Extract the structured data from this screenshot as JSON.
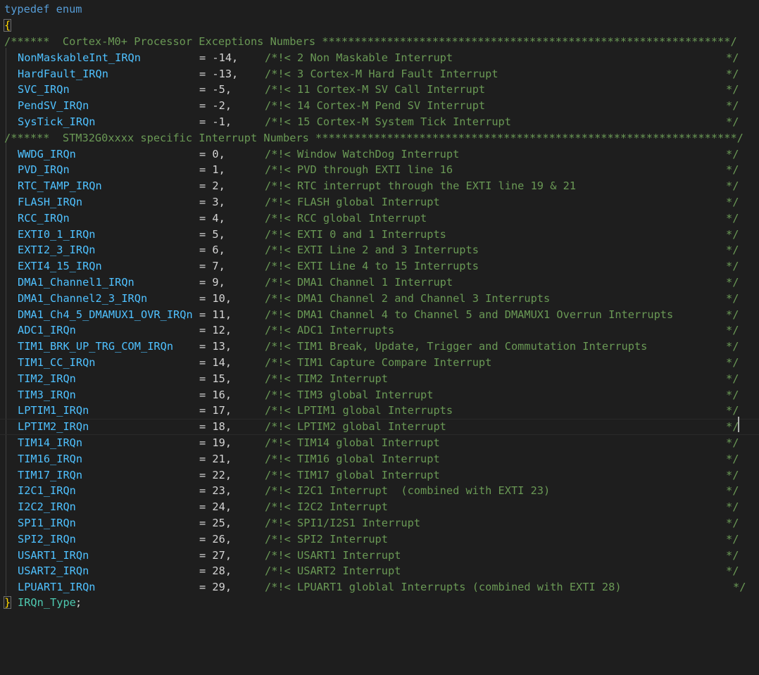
{
  "header": {
    "keyword": "typedef enum",
    "open_brace": "{"
  },
  "sections": [
    {
      "text": "/******  Cortex-M0+ Processor Exceptions Numbers ***************************************************************/"
    },
    {
      "text": "/******  STM32G0xxxx specific Interrupt Numbers *****************************************************************/"
    }
  ],
  "enumerators": [
    {
      "name": "NonMaskableInt_IRQn",
      "value": "= -14,",
      "comment": "/*!< 2 Non Maskable Interrupt",
      "end": "*/"
    },
    {
      "name": "HardFault_IRQn",
      "value": "= -13,",
      "comment": "/*!< 3 Cortex-M Hard Fault Interrupt",
      "end": "*/"
    },
    {
      "name": "SVC_IRQn",
      "value": "= -5,",
      "comment": "/*!< 11 Cortex-M SV Call Interrupt",
      "end": "*/"
    },
    {
      "name": "PendSV_IRQn",
      "value": "= -2,",
      "comment": "/*!< 14 Cortex-M Pend SV Interrupt",
      "end": "*/"
    },
    {
      "name": "SysTick_IRQn",
      "value": "= -1,",
      "comment": "/*!< 15 Cortex-M System Tick Interrupt",
      "end": "*/"
    },
    {
      "name": "WWDG_IRQn",
      "value": "= 0,",
      "comment": "/*!< Window WatchDog Interrupt",
      "end": "*/"
    },
    {
      "name": "PVD_IRQn",
      "value": "= 1,",
      "comment": "/*!< PVD through EXTI line 16",
      "end": "*/"
    },
    {
      "name": "RTC_TAMP_IRQn",
      "value": "= 2,",
      "comment": "/*!< RTC interrupt through the EXTI line 19 & 21",
      "end": "*/"
    },
    {
      "name": "FLASH_IRQn",
      "value": "= 3,",
      "comment": "/*!< FLASH global Interrupt",
      "end": "*/"
    },
    {
      "name": "RCC_IRQn",
      "value": "= 4,",
      "comment": "/*!< RCC global Interrupt",
      "end": "*/"
    },
    {
      "name": "EXTI0_1_IRQn",
      "value": "= 5,",
      "comment": "/*!< EXTI 0 and 1 Interrupts",
      "end": "*/"
    },
    {
      "name": "EXTI2_3_IRQn",
      "value": "= 6,",
      "comment": "/*!< EXTI Line 2 and 3 Interrupts",
      "end": "*/"
    },
    {
      "name": "EXTI4_15_IRQn",
      "value": "= 7,",
      "comment": "/*!< EXTI Line 4 to 15 Interrupts",
      "end": "*/"
    },
    {
      "name": "DMA1_Channel1_IRQn",
      "value": "= 9,",
      "comment": "/*!< DMA1 Channel 1 Interrupt",
      "end": "*/"
    },
    {
      "name": "DMA1_Channel2_3_IRQn",
      "value": "= 10,",
      "comment": "/*!< DMA1 Channel 2 and Channel 3 Interrupts",
      "end": "*/"
    },
    {
      "name": "DMA1_Ch4_5_DMAMUX1_OVR_IRQn",
      "value": "= 11,",
      "comment": "/*!< DMA1 Channel 4 to Channel 5 and DMAMUX1 Overrun Interrupts",
      "end": "*/"
    },
    {
      "name": "ADC1_IRQn",
      "value": "= 12,",
      "comment": "/*!< ADC1 Interrupts",
      "end": "*/"
    },
    {
      "name": "TIM1_BRK_UP_TRG_COM_IRQn",
      "value": "= 13,",
      "comment": "/*!< TIM1 Break, Update, Trigger and Commutation Interrupts",
      "end": "*/"
    },
    {
      "name": "TIM1_CC_IRQn",
      "value": "= 14,",
      "comment": "/*!< TIM1 Capture Compare Interrupt",
      "end": "*/"
    },
    {
      "name": "TIM2_IRQn",
      "value": "= 15,",
      "comment": "/*!< TIM2 Interrupt",
      "end": "*/"
    },
    {
      "name": "TIM3_IRQn",
      "value": "= 16,",
      "comment": "/*!< TIM3 global Interrupt",
      "end": "*/"
    },
    {
      "name": "LPTIM1_IRQn",
      "value": "= 17,",
      "comment": "/*!< LPTIM1 global Interrupts",
      "end": "*/"
    },
    {
      "name": "LPTIM2_IRQn",
      "value": "= 18,",
      "comment": "/*!< LPTIM2 global Interrupt",
      "end": "*/"
    },
    {
      "name": "TIM14_IRQn",
      "value": "= 19,",
      "comment": "/*!< TIM14 global Interrupt",
      "end": "*/"
    },
    {
      "name": "TIM16_IRQn",
      "value": "= 21,",
      "comment": "/*!< TIM16 global Interrupt",
      "end": "*/"
    },
    {
      "name": "TIM17_IRQn",
      "value": "= 22,",
      "comment": "/*!< TIM17 global Interrupt",
      "end": "*/"
    },
    {
      "name": "I2C1_IRQn",
      "value": "= 23,",
      "comment": "/*!< I2C1 Interrupt  (combined with EXTI 23)",
      "end": "*/"
    },
    {
      "name": "I2C2_IRQn",
      "value": "= 24,",
      "comment": "/*!< I2C2 Interrupt",
      "end": "*/"
    },
    {
      "name": "SPI1_IRQn",
      "value": "= 25,",
      "comment": "/*!< SPI1/I2S1 Interrupt",
      "end": "*/"
    },
    {
      "name": "SPI2_IRQn",
      "value": "= 26,",
      "comment": "/*!< SPI2 Interrupt",
      "end": "*/"
    },
    {
      "name": "USART1_IRQn",
      "value": "= 27,",
      "comment": "/*!< USART1 Interrupt",
      "end": "*/"
    },
    {
      "name": "USART2_IRQn",
      "value": "= 28,",
      "comment": "/*!< USART2 Interrupt",
      "end": "*/"
    },
    {
      "name": "LPUART1_IRQn",
      "value": "= 29,",
      "comment": "/*!< LPUART1 globlal Interrupts (combined with EXTI 28)",
      "end": "*/"
    }
  ],
  "footer": {
    "close_brace": "}",
    "type_name": "IRQn_Type",
    "semicolon": ";"
  },
  "colors": {
    "background": "#1e1e1e",
    "keyword": "#569cd6",
    "enum_member": "#4fc1ff",
    "type": "#4ec9b0",
    "comment": "#6a9955",
    "bracket": "#ffd700"
  }
}
